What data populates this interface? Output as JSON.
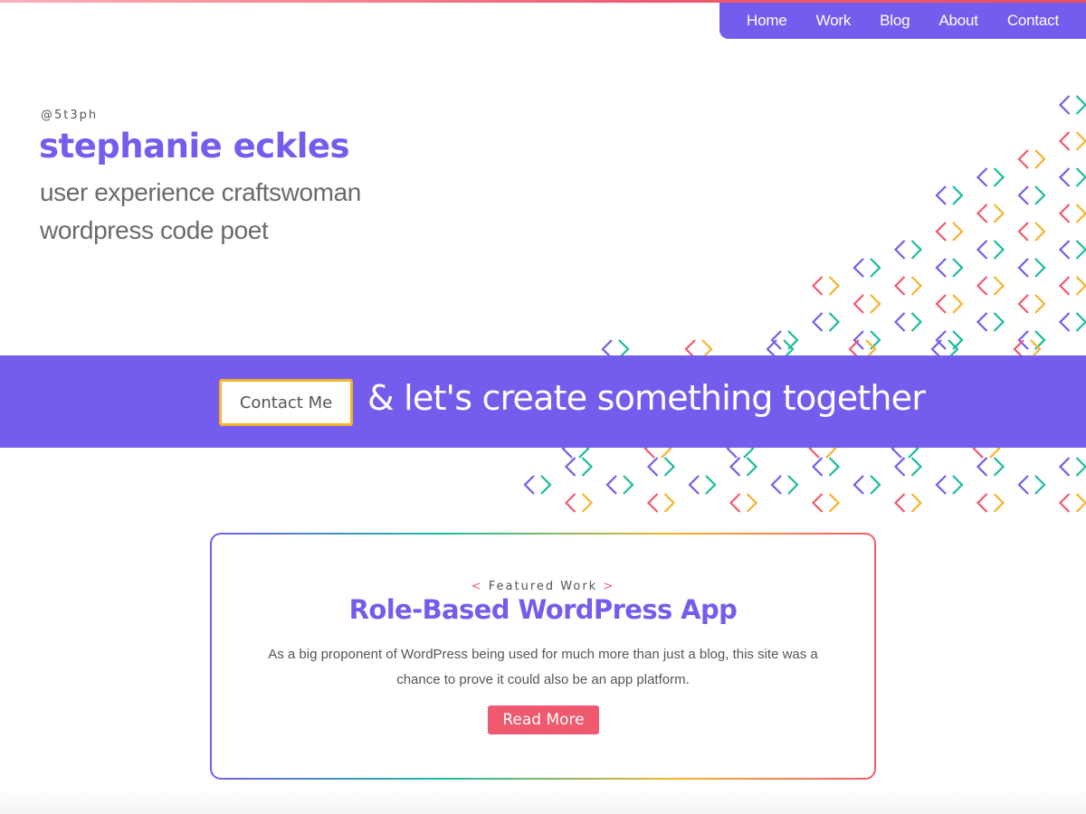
{
  "nav": {
    "items": [
      {
        "label": "Home"
      },
      {
        "label": "Work"
      },
      {
        "label": "Blog"
      },
      {
        "label": "About"
      },
      {
        "label": "Contact"
      }
    ]
  },
  "hero": {
    "handle": "@5t3ph",
    "name": "stephanie eckles",
    "tagline_1": "user experience craftswoman",
    "tagline_2": "wordpress code poet"
  },
  "cta": {
    "button_label": "Contact Me",
    "text": "& let's create something together"
  },
  "featured": {
    "eyebrow_open": "<",
    "eyebrow": "Featured Work",
    "eyebrow_close": ">",
    "title": "Role-Based WordPress App",
    "body": "As a big proponent of WordPress being used for much more than just a blog, this site was a chance to prove it could also be an app platform.",
    "button_label": "Read More"
  },
  "pattern": {
    "icon": "code-brackets-icon",
    "colors": [
      "#745dec",
      "#1abc9c",
      "#f05a6e",
      "#f7b32b"
    ]
  },
  "colors": {
    "accent": "#745dec",
    "coral": "#f05a6e",
    "gold": "#f7b32b",
    "teal": "#1abc9c"
  }
}
